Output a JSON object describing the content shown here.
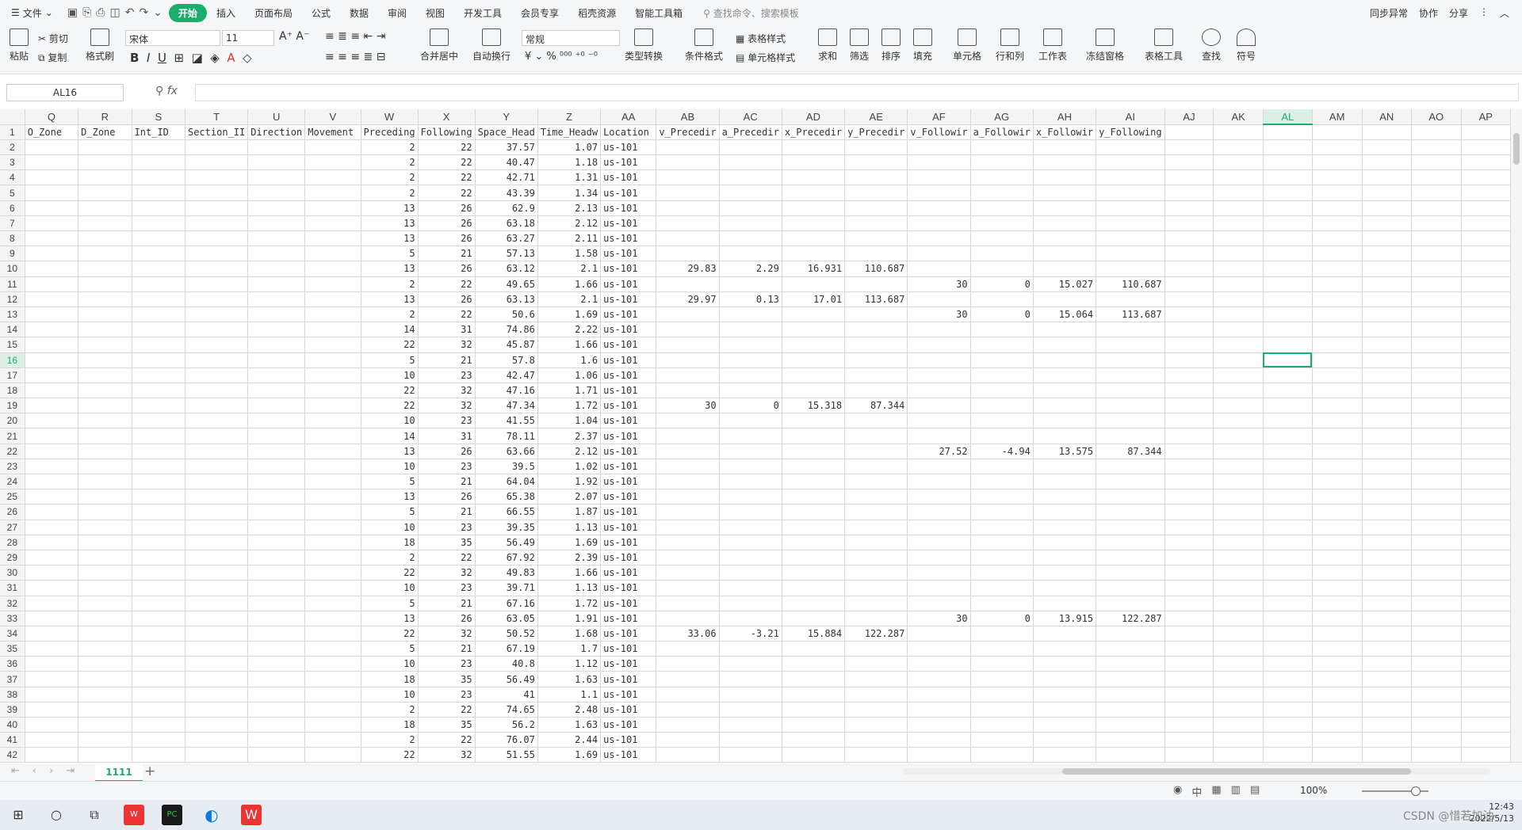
{
  "menu": {
    "file": "文件",
    "tabs": [
      "开始",
      "插入",
      "页面布局",
      "公式",
      "数据",
      "审阅",
      "视图",
      "开发工具",
      "会员专享",
      "稻壳资源",
      "智能工具箱"
    ],
    "search": "查找命令、搜索模板",
    "right": [
      "同步异常",
      "协作",
      "分享"
    ]
  },
  "ribbon": {
    "paste": "粘贴",
    "cut": "剪切",
    "copy": "复制",
    "format_painter": "格式刷",
    "font": "宋体",
    "size": "11",
    "merge": "合并居中",
    "wrap": "自动换行",
    "numfmt": "常规",
    "convert": "类型转换",
    "cond_format": "条件格式",
    "table_style": "表格样式",
    "cell_style": "单元格样式",
    "sum": "求和",
    "filter": "筛选",
    "sort": "排序",
    "fill": "填充",
    "cell": "单元格",
    "rowcol": "行和列",
    "sheet": "工作表",
    "freeze": "冻结窗格",
    "tools": "表格工具",
    "find": "查找",
    "symbol": "符号"
  },
  "namebox": "AL16",
  "fx": "fx",
  "columns": [
    "Q",
    "R",
    "S",
    "T",
    "U",
    "V",
    "W",
    "X",
    "Y",
    "Z",
    "AA",
    "AB",
    "AC",
    "AD",
    "AE",
    "AF",
    "AG",
    "AH",
    "AI",
    "AJ",
    "AK",
    "AL",
    "AM",
    "AN",
    "AO",
    "AP"
  ],
  "selected_col": "AL",
  "selected_row": "16",
  "header_row": [
    "O_Zone",
    "D_Zone",
    "Int_ID",
    "Section_II",
    "Direction",
    "Movement",
    "Preceding",
    "Following",
    "Space_Head",
    "Time_Headw",
    "Location",
    "v_Precedir",
    "a_Precedir",
    "x_Precedir",
    "y_Precedir",
    "v_Followir",
    "a_Followir",
    "x_Followir",
    "y_Following",
    "",
    "",
    "",
    "",
    "",
    "",
    ""
  ],
  "rows": [
    [
      "2",
      "2",
      "22",
      "37.57",
      "1.07",
      "us-101",
      "",
      "",
      "",
      "",
      "",
      "",
      "",
      ""
    ],
    [
      "3",
      "2",
      "22",
      "40.47",
      "1.18",
      "us-101",
      "",
      "",
      "",
      "",
      "",
      "",
      "",
      ""
    ],
    [
      "4",
      "2",
      "22",
      "42.71",
      "1.31",
      "us-101",
      "",
      "",
      "",
      "",
      "",
      "",
      "",
      ""
    ],
    [
      "5",
      "2",
      "22",
      "43.39",
      "1.34",
      "us-101",
      "",
      "",
      "",
      "",
      "",
      "",
      "",
      ""
    ],
    [
      "6",
      "13",
      "26",
      "62.9",
      "2.13",
      "us-101",
      "",
      "",
      "",
      "",
      "",
      "",
      "",
      ""
    ],
    [
      "7",
      "13",
      "26",
      "63.18",
      "2.12",
      "us-101",
      "",
      "",
      "",
      "",
      "",
      "",
      "",
      ""
    ],
    [
      "8",
      "13",
      "26",
      "63.27",
      "2.11",
      "us-101",
      "",
      "",
      "",
      "",
      "",
      "",
      "",
      ""
    ],
    [
      "9",
      "5",
      "21",
      "57.13",
      "1.58",
      "us-101",
      "",
      "",
      "",
      "",
      "",
      "",
      "",
      ""
    ],
    [
      "10",
      "13",
      "26",
      "63.12",
      "2.1",
      "us-101",
      "29.83",
      "2.29",
      "16.931",
      "110.687",
      "",
      "",
      "",
      ""
    ],
    [
      "11",
      "2",
      "22",
      "49.65",
      "1.66",
      "us-101",
      "",
      "",
      "",
      "",
      "30",
      "0",
      "15.027",
      "110.687"
    ],
    [
      "12",
      "13",
      "26",
      "63.13",
      "2.1",
      "us-101",
      "29.97",
      "0.13",
      "17.01",
      "113.687",
      "",
      "",
      "",
      ""
    ],
    [
      "13",
      "2",
      "22",
      "50.6",
      "1.69",
      "us-101",
      "",
      "",
      "",
      "",
      "30",
      "0",
      "15.064",
      "113.687"
    ],
    [
      "14",
      "14",
      "31",
      "74.86",
      "2.22",
      "us-101",
      "",
      "",
      "",
      "",
      "",
      "",
      "",
      ""
    ],
    [
      "15",
      "22",
      "32",
      "45.87",
      "1.66",
      "us-101",
      "",
      "",
      "",
      "",
      "",
      "",
      "",
      ""
    ],
    [
      "16",
      "5",
      "21",
      "57.8",
      "1.6",
      "us-101",
      "",
      "",
      "",
      "",
      "",
      "",
      "",
      ""
    ],
    [
      "17",
      "10",
      "23",
      "42.47",
      "1.06",
      "us-101",
      "",
      "",
      "",
      "",
      "",
      "",
      "",
      ""
    ],
    [
      "18",
      "22",
      "32",
      "47.16",
      "1.71",
      "us-101",
      "",
      "",
      "",
      "",
      "",
      "",
      "",
      ""
    ],
    [
      "19",
      "22",
      "32",
      "47.34",
      "1.72",
      "us-101",
      "30",
      "0",
      "15.318",
      "87.344",
      "",
      "",
      "",
      ""
    ],
    [
      "20",
      "10",
      "23",
      "41.55",
      "1.04",
      "us-101",
      "",
      "",
      "",
      "",
      "",
      "",
      "",
      ""
    ],
    [
      "21",
      "14",
      "31",
      "78.11",
      "2.37",
      "us-101",
      "",
      "",
      "",
      "",
      "",
      "",
      "",
      ""
    ],
    [
      "22",
      "13",
      "26",
      "63.66",
      "2.12",
      "us-101",
      "",
      "",
      "",
      "",
      "27.52",
      "-4.94",
      "13.575",
      "87.344"
    ],
    [
      "23",
      "10",
      "23",
      "39.5",
      "1.02",
      "us-101",
      "",
      "",
      "",
      "",
      "",
      "",
      "",
      ""
    ],
    [
      "24",
      "5",
      "21",
      "64.04",
      "1.92",
      "us-101",
      "",
      "",
      "",
      "",
      "",
      "",
      "",
      ""
    ],
    [
      "25",
      "13",
      "26",
      "65.38",
      "2.07",
      "us-101",
      "",
      "",
      "",
      "",
      "",
      "",
      "",
      ""
    ],
    [
      "26",
      "5",
      "21",
      "66.55",
      "1.87",
      "us-101",
      "",
      "",
      "",
      "",
      "",
      "",
      "",
      ""
    ],
    [
      "27",
      "10",
      "23",
      "39.35",
      "1.13",
      "us-101",
      "",
      "",
      "",
      "",
      "",
      "",
      "",
      ""
    ],
    [
      "28",
      "18",
      "35",
      "56.49",
      "1.69",
      "us-101",
      "",
      "",
      "",
      "",
      "",
      "",
      "",
      ""
    ],
    [
      "29",
      "2",
      "22",
      "67.92",
      "2.39",
      "us-101",
      "",
      "",
      "",
      "",
      "",
      "",
      "",
      ""
    ],
    [
      "30",
      "22",
      "32",
      "49.83",
      "1.66",
      "us-101",
      "",
      "",
      "",
      "",
      "",
      "",
      "",
      ""
    ],
    [
      "31",
      "10",
      "23",
      "39.71",
      "1.13",
      "us-101",
      "",
      "",
      "",
      "",
      "",
      "",
      "",
      ""
    ],
    [
      "32",
      "5",
      "21",
      "67.16",
      "1.72",
      "us-101",
      "",
      "",
      "",
      "",
      "",
      "",
      "",
      ""
    ],
    [
      "33",
      "13",
      "26",
      "63.05",
      "1.91",
      "us-101",
      "",
      "",
      "",
      "",
      "30",
      "0",
      "13.915",
      "122.287"
    ],
    [
      "34",
      "22",
      "32",
      "50.52",
      "1.68",
      "us-101",
      "33.06",
      "-3.21",
      "15.884",
      "122.287",
      "",
      "",
      "",
      ""
    ],
    [
      "35",
      "5",
      "21",
      "67.19",
      "1.7",
      "us-101",
      "",
      "",
      "",
      "",
      "",
      "",
      "",
      ""
    ],
    [
      "36",
      "10",
      "23",
      "40.8",
      "1.12",
      "us-101",
      "",
      "",
      "",
      "",
      "",
      "",
      "",
      ""
    ],
    [
      "37",
      "18",
      "35",
      "56.49",
      "1.63",
      "us-101",
      "",
      "",
      "",
      "",
      "",
      "",
      "",
      ""
    ],
    [
      "38",
      "10",
      "23",
      "41",
      "1.1",
      "us-101",
      "",
      "",
      "",
      "",
      "",
      "",
      "",
      ""
    ],
    [
      "39",
      "2",
      "22",
      "74.65",
      "2.48",
      "us-101",
      "",
      "",
      "",
      "",
      "",
      "",
      "",
      ""
    ],
    [
      "40",
      "18",
      "35",
      "56.2",
      "1.63",
      "us-101",
      "",
      "",
      "",
      "",
      "",
      "",
      "",
      ""
    ],
    [
      "41",
      "2",
      "22",
      "76.07",
      "2.44",
      "us-101",
      "",
      "",
      "",
      "",
      "",
      "",
      "",
      ""
    ],
    [
      "42",
      "22",
      "32",
      "51.55",
      "1.69",
      "us-101",
      "",
      "",
      "",
      "",
      "",
      "",
      "",
      ""
    ]
  ],
  "sheet_tab": "1111",
  "zoom": "100%",
  "clock": {
    "time": "12:43",
    "date": "2022/5/13"
  },
  "watermark": "CSDN @惜若加油"
}
